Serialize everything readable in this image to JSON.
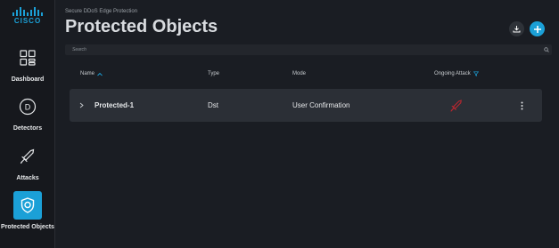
{
  "brand": {
    "logo_text": "CISCO"
  },
  "sidebar": {
    "items": [
      {
        "label": "Dashboard",
        "icon": "dashboard-grid-icon"
      },
      {
        "label": "Detectors",
        "icon": "detector-d-icon"
      },
      {
        "label": "Attacks",
        "icon": "attack-sword-icon"
      },
      {
        "label": "Protected Objects",
        "icon": "shield-icon"
      }
    ],
    "active_index": 3
  },
  "header": {
    "subtitle": "Secure DDoS Edge Protection",
    "title": "Protected Objects"
  },
  "search": {
    "placeholder": "Search"
  },
  "table": {
    "columns": [
      "Name",
      "Type",
      "Mode",
      "Ongoing Attack"
    ],
    "sorted_column": "Name",
    "filtered_column": "Ongoing Attack",
    "rows": [
      {
        "name": "Protected-1",
        "type": "Dst",
        "mode": "User Confirmation",
        "ongoing_attack_icon": "attack-sword-icon"
      }
    ]
  },
  "colors": {
    "accent": "#1ba0d7",
    "background": "#1a1d23",
    "sidebar": "#16181d",
    "row": "#2b2f36",
    "attack_red": "#c0262f"
  }
}
